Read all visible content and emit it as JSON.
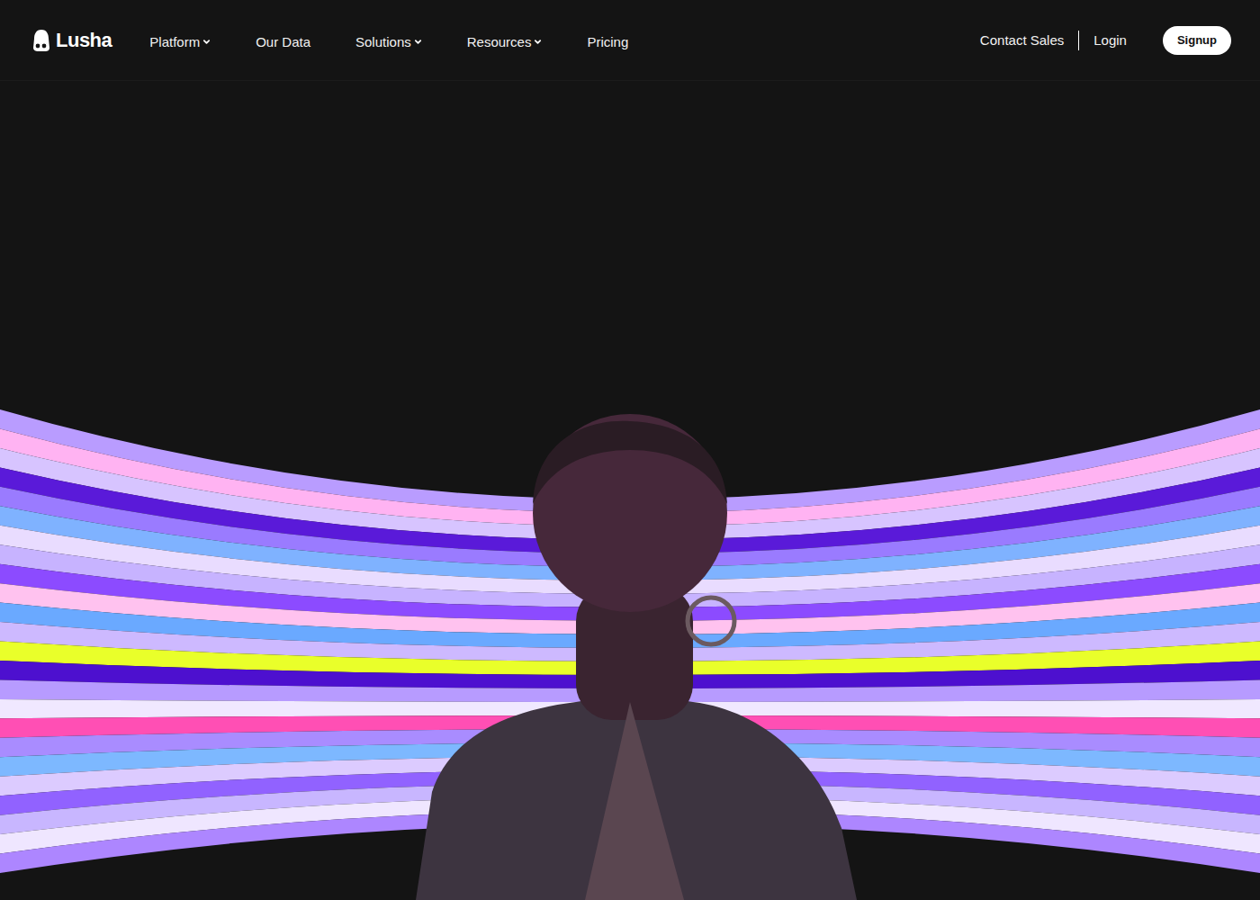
{
  "logo": {
    "text": "Lusha"
  },
  "nav": {
    "items": [
      {
        "label": "Platform",
        "has_menu": true
      },
      {
        "label": "Our Data",
        "has_menu": false
      },
      {
        "label": "Solutions",
        "has_menu": true
      },
      {
        "label": "Resources",
        "has_menu": true
      },
      {
        "label": "Pricing",
        "has_menu": false
      }
    ]
  },
  "actions": {
    "contact": "Contact Sales",
    "login": "Login",
    "signup": "Signup"
  }
}
